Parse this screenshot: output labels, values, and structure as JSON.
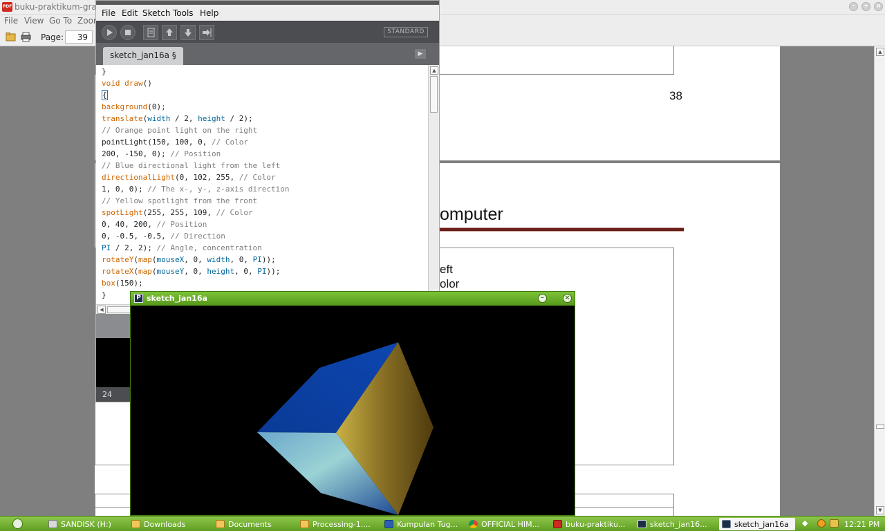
{
  "pdf_reader": {
    "title": "buku-praktikum-graf",
    "menu": [
      "File",
      "View",
      "Go To",
      "Zoom"
    ],
    "page_label": "Page:",
    "current_page": "39",
    "page_number_text": "38",
    "heading_fragment": "omputer",
    "text_fragments": [
      "eft",
      "olor"
    ]
  },
  "ide": {
    "menu": [
      "File",
      "Edit",
      "Sketch",
      "Tools",
      "Help"
    ],
    "mode_label": "STANDARD",
    "tab_label": "sketch_jan16a §",
    "line_number": "24",
    "code_lines": [
      [
        {
          "t": "}",
          "c": ""
        }
      ],
      [
        {
          "t": "void ",
          "c": "kw"
        },
        {
          "t": "draw",
          "c": "kw"
        },
        {
          "t": "()",
          "c": ""
        }
      ],
      [
        {
          "t": "{",
          "c": "caret"
        }
      ],
      [
        {
          "t": "background",
          "c": "kw"
        },
        {
          "t": "(0);",
          "c": ""
        }
      ],
      [
        {
          "t": "translate",
          "c": "kw"
        },
        {
          "t": "(",
          "c": ""
        },
        {
          "t": "width",
          "c": "cst"
        },
        {
          "t": " / 2, ",
          "c": ""
        },
        {
          "t": "height",
          "c": "cst"
        },
        {
          "t": " / 2);",
          "c": ""
        }
      ],
      [
        {
          "t": "// Orange point light on the right",
          "c": "cmt"
        }
      ],
      [
        {
          "t": "pointLight(150, 100, 0, ",
          "c": ""
        },
        {
          "t": "// Color",
          "c": "cmt"
        }
      ],
      [
        {
          "t": "200, -150, 0); ",
          "c": ""
        },
        {
          "t": "// Position",
          "c": "cmt"
        }
      ],
      [
        {
          "t": "// Blue directional light from the left",
          "c": "cmt"
        }
      ],
      [
        {
          "t": "directionalLight",
          "c": "kw"
        },
        {
          "t": "(0, 102, 255, ",
          "c": ""
        },
        {
          "t": "// Color",
          "c": "cmt"
        }
      ],
      [
        {
          "t": "1, 0, 0); ",
          "c": ""
        },
        {
          "t": "// The x-, y-, z-axis direction",
          "c": "cmt"
        }
      ],
      [
        {
          "t": "// Yellow spotlight from the front",
          "c": "cmt"
        }
      ],
      [
        {
          "t": "spotLight",
          "c": "kw"
        },
        {
          "t": "(255, 255, 109, ",
          "c": ""
        },
        {
          "t": "// Color",
          "c": "cmt"
        }
      ],
      [
        {
          "t": "0, 40, 200, ",
          "c": ""
        },
        {
          "t": "// Position",
          "c": "cmt"
        }
      ],
      [
        {
          "t": "0, -0.5, -0.5, ",
          "c": ""
        },
        {
          "t": "// Direction",
          "c": "cmt"
        }
      ],
      [
        {
          "t": "PI",
          "c": "cst"
        },
        {
          "t": " / 2, 2); ",
          "c": ""
        },
        {
          "t": "// Angle, concentration",
          "c": "cmt"
        }
      ],
      [
        {
          "t": "rotateY",
          "c": "kw"
        },
        {
          "t": "(",
          "c": ""
        },
        {
          "t": "map",
          "c": "kw"
        },
        {
          "t": "(",
          "c": ""
        },
        {
          "t": "mouseX",
          "c": "cst"
        },
        {
          "t": ", 0, ",
          "c": ""
        },
        {
          "t": "width",
          "c": "cst"
        },
        {
          "t": ", 0, ",
          "c": ""
        },
        {
          "t": "PI",
          "c": "cst"
        },
        {
          "t": "));",
          "c": ""
        }
      ],
      [
        {
          "t": "rotateX",
          "c": "kw"
        },
        {
          "t": "(",
          "c": ""
        },
        {
          "t": "map",
          "c": "kw"
        },
        {
          "t": "(",
          "c": ""
        },
        {
          "t": "mouseY",
          "c": "cst"
        },
        {
          "t": ", 0, ",
          "c": ""
        },
        {
          "t": "height",
          "c": "cst"
        },
        {
          "t": ", 0, ",
          "c": ""
        },
        {
          "t": "PI",
          "c": "cst"
        },
        {
          "t": "));",
          "c": ""
        }
      ],
      [
        {
          "t": "box",
          "c": "kw"
        },
        {
          "t": "(150);",
          "c": ""
        }
      ],
      [
        {
          "t": "}",
          "c": ""
        }
      ]
    ]
  },
  "sketch_window": {
    "title": "sketch_jan16a"
  },
  "taskbar": {
    "items": [
      {
        "label": "SANDISK (H:)",
        "icon": "drive-icon"
      },
      {
        "label": "Downloads",
        "icon": "folder-icon"
      },
      {
        "label": "Documents",
        "icon": "folder-icon"
      },
      {
        "label": "Processing-1....",
        "icon": "folder-icon"
      },
      {
        "label": "Kumpulan Tug...",
        "icon": "word-document-icon"
      },
      {
        "label": "OFFICIAL HIM...",
        "icon": "chrome-icon"
      },
      {
        "label": "buku-praktiku...",
        "icon": "pdf-icon"
      },
      {
        "label": "sketch_jan16...",
        "icon": "processing-icon"
      },
      {
        "label": "sketch_jan16a",
        "icon": "processing-icon",
        "active": true
      }
    ],
    "clock": "12:21 PM"
  },
  "colors": {
    "taskbar": "#6faf2d",
    "ide_toolbar": "#4c4d51",
    "keyword": "#cc6600",
    "comment": "#7e7e7e",
    "constant": "#006699",
    "pdf_rule": "#6b1e18"
  }
}
